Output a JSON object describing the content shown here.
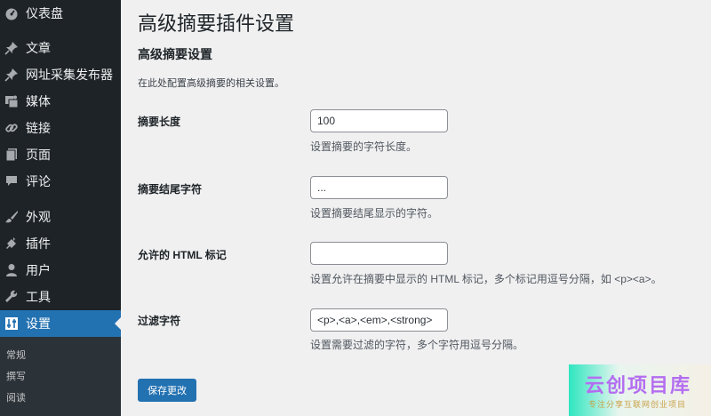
{
  "sidebar": {
    "items": [
      {
        "label": "仪表盘",
        "icon": "dashboard-icon"
      },
      {
        "label": "文章",
        "icon": "pin-icon"
      },
      {
        "label": "网址采集发布器",
        "icon": "pin-icon"
      },
      {
        "label": "媒体",
        "icon": "media-icon"
      },
      {
        "label": "链接",
        "icon": "link-icon"
      },
      {
        "label": "页面",
        "icon": "page-icon"
      },
      {
        "label": "评论",
        "icon": "comment-icon"
      },
      {
        "label": "外观",
        "icon": "brush-icon"
      },
      {
        "label": "插件",
        "icon": "plugin-icon"
      },
      {
        "label": "用户",
        "icon": "user-icon"
      },
      {
        "label": "工具",
        "icon": "wrench-icon"
      },
      {
        "label": "设置",
        "icon": "settings-icon"
      }
    ],
    "submenu": [
      "常规",
      "撰写",
      "阅读"
    ]
  },
  "page": {
    "title": "高级摘要插件设置",
    "section_title": "高级摘要设置",
    "section_desc": "在此处配置高级摘要的相关设置。"
  },
  "fields": [
    {
      "label": "摘要长度",
      "value": "100",
      "desc": "设置摘要的字符长度。"
    },
    {
      "label": "摘要结尾字符",
      "value": "...",
      "desc": "设置摘要结尾显示的字符。"
    },
    {
      "label": "允许的 HTML 标记",
      "value": "",
      "desc": "设置允许在摘要中显示的 HTML 标记，多个标记用逗号分隔，如 <p><a>。"
    },
    {
      "label": "过滤字符",
      "value": "<p>,<a>,<em>,<strong>",
      "desc": "设置需要过滤的字符，多个字符用逗号分隔。"
    }
  ],
  "save_label": "保存更改",
  "watermark": {
    "title": "云创项目库",
    "subtitle": "专注分享互联网创业项目"
  },
  "colors": {
    "sidebar": "#1d2327",
    "active": "#2271b1",
    "page_bg": "#f0f0f1"
  }
}
